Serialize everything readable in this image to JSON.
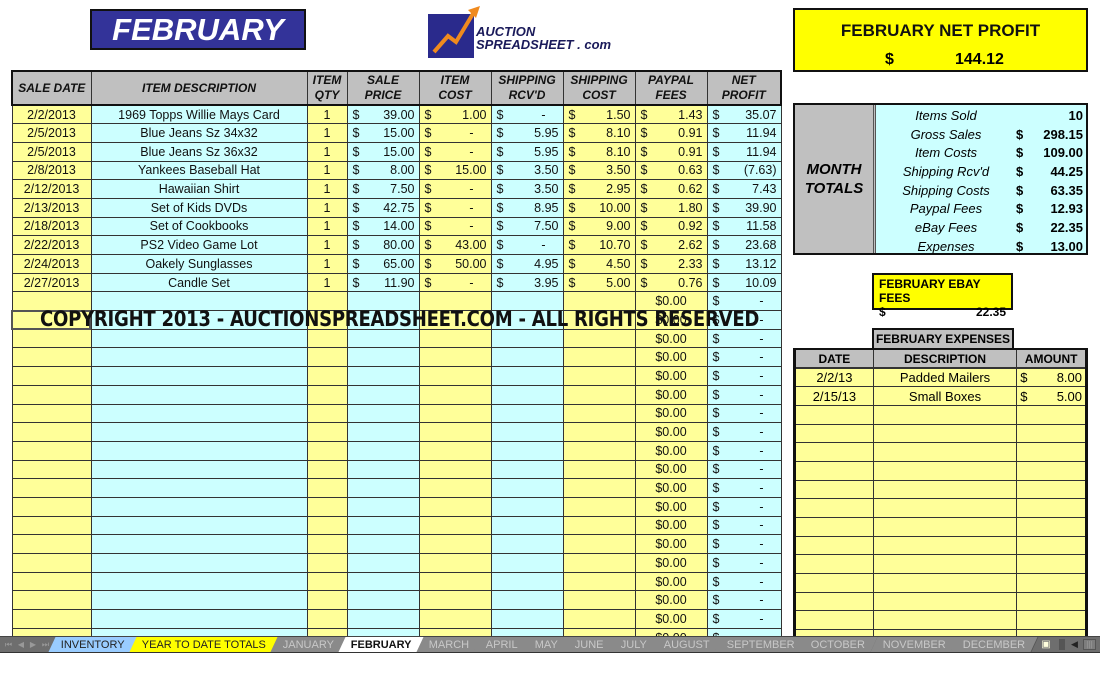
{
  "header": {
    "month_title": "FEBRUARY",
    "logo_line1": "AUCTION",
    "logo_line2": "SPREADSHEET . com",
    "net_profit_label": "FEBRUARY NET PROFIT",
    "net_profit_currency": "$",
    "net_profit_value": "144.12"
  },
  "sales_table": {
    "columns": [
      "SALE DATE",
      "ITEM DESCRIPTION",
      "ITEM QTY",
      "SALE PRICE",
      "ITEM COST",
      "SHIPPING RCV'D",
      "SHIPPING COST",
      "PAYPAL FEES",
      "NET PROFIT"
    ],
    "column_lines": [
      [
        "SALE DATE"
      ],
      [
        "ITEM DESCRIPTION"
      ],
      [
        "ITEM",
        "QTY"
      ],
      [
        "SALE",
        "PRICE"
      ],
      [
        "ITEM",
        "COST"
      ],
      [
        "SHIPPING",
        "RCV'D"
      ],
      [
        "SHIPPING",
        "COST"
      ],
      [
        "PAYPAL",
        "FEES"
      ],
      [
        "NET",
        "PROFIT"
      ]
    ],
    "rows": [
      {
        "date": "2/2/2013",
        "desc": "1969 Topps Willie Mays Card",
        "qty": "1",
        "price": "39.00",
        "cost": "1.00",
        "ship_rcvd": "-",
        "ship_cost": "1.50",
        "paypal": "1.43",
        "net": "35.07"
      },
      {
        "date": "2/5/2013",
        "desc": "Blue Jeans Sz 34x32",
        "qty": "1",
        "price": "15.00",
        "cost": "-",
        "ship_rcvd": "5.95",
        "ship_cost": "8.10",
        "paypal": "0.91",
        "net": "11.94"
      },
      {
        "date": "2/5/2013",
        "desc": "Blue Jeans Sz 36x32",
        "qty": "1",
        "price": "15.00",
        "cost": "-",
        "ship_rcvd": "5.95",
        "ship_cost": "8.10",
        "paypal": "0.91",
        "net": "11.94"
      },
      {
        "date": "2/8/2013",
        "desc": "Yankees Baseball Hat",
        "qty": "1",
        "price": "8.00",
        "cost": "15.00",
        "ship_rcvd": "3.50",
        "ship_cost": "3.50",
        "paypal": "0.63",
        "net": "(7.63)"
      },
      {
        "date": "2/12/2013",
        "desc": "Hawaiian Shirt",
        "qty": "1",
        "price": "7.50",
        "cost": "-",
        "ship_rcvd": "3.50",
        "ship_cost": "2.95",
        "paypal": "0.62",
        "net": "7.43"
      },
      {
        "date": "2/13/2013",
        "desc": "Set of Kids DVDs",
        "qty": "1",
        "price": "42.75",
        "cost": "-",
        "ship_rcvd": "8.95",
        "ship_cost": "10.00",
        "paypal": "1.80",
        "net": "39.90"
      },
      {
        "date": "2/18/2013",
        "desc": "Set of Cookbooks",
        "qty": "1",
        "price": "14.00",
        "cost": "-",
        "ship_rcvd": "7.50",
        "ship_cost": "9.00",
        "paypal": "0.92",
        "net": "11.58"
      },
      {
        "date": "2/22/2013",
        "desc": "PS2 Video Game Lot",
        "qty": "1",
        "price": "80.00",
        "cost": "43.00",
        "ship_rcvd": "-",
        "ship_cost": "10.70",
        "paypal": "2.62",
        "net": "23.68"
      },
      {
        "date": "2/24/2013",
        "desc": "Oakely Sunglasses",
        "qty": "1",
        "price": "65.00",
        "cost": "50.00",
        "ship_rcvd": "4.95",
        "ship_cost": "4.50",
        "paypal": "2.33",
        "net": "13.12"
      },
      {
        "date": "2/27/2013",
        "desc": "Candle Set",
        "qty": "1",
        "price": "11.90",
        "cost": "-",
        "ship_rcvd": "3.95",
        "ship_cost": "5.00",
        "paypal": "0.76",
        "net": "10.09"
      }
    ],
    "empty_row_paypal": "$0.00",
    "empty_row_net_currency": "$",
    "empty_row_net_value": "-",
    "empty_row_count": 19,
    "currency": "$"
  },
  "watermark": "COPYRIGHT 2013 - AUCTIONSPREADSHEET.COM - ALL RIGHTS RESERVED",
  "month_totals": {
    "label_line1": "MONTH",
    "label_line2": "TOTALS",
    "rows": [
      {
        "label": "Items Sold",
        "currency": "",
        "value": "10"
      },
      {
        "label": "Gross Sales",
        "currency": "$",
        "value": "298.15"
      },
      {
        "label": "Item Costs",
        "currency": "$",
        "value": "109.00"
      },
      {
        "label": "Shipping Rcv'd",
        "currency": "$",
        "value": "44.25"
      },
      {
        "label": "Shipping Costs",
        "currency": "$",
        "value": "63.35"
      },
      {
        "label": "Paypal Fees",
        "currency": "$",
        "value": "12.93"
      },
      {
        "label": "eBay Fees",
        "currency": "$",
        "value": "22.35"
      },
      {
        "label": "Expenses",
        "currency": "$",
        "value": "13.00"
      }
    ]
  },
  "ebay_fees": {
    "label": "FEBRUARY EBAY FEES",
    "currency": "$",
    "value": "22.35"
  },
  "expenses": {
    "title": "FEBRUARY EXPENSES",
    "columns": [
      "DATE",
      "DESCRIPTION",
      "AMOUNT"
    ],
    "rows": [
      {
        "date": "2/2/13",
        "desc": "Padded Mailers",
        "currency": "$",
        "amount": "8.00"
      },
      {
        "date": "2/15/13",
        "desc": "Small Boxes",
        "currency": "$",
        "amount": "5.00"
      }
    ],
    "empty_row_count": 13
  },
  "sheet_tabs": {
    "tabs": [
      {
        "label": "INVENTORY",
        "style": "inv"
      },
      {
        "label": "YEAR TO DATE TOTALS",
        "style": "ytd"
      },
      {
        "label": "JANUARY",
        "style": ""
      },
      {
        "label": "FEBRUARY",
        "style": "active"
      },
      {
        "label": "MARCH",
        "style": ""
      },
      {
        "label": "APRIL",
        "style": ""
      },
      {
        "label": "MAY",
        "style": ""
      },
      {
        "label": "JUNE",
        "style": ""
      },
      {
        "label": "JULY",
        "style": ""
      },
      {
        "label": "AUGUST",
        "style": ""
      },
      {
        "label": "SEPTEMBER",
        "style": ""
      },
      {
        "label": "OCTOBER",
        "style": ""
      },
      {
        "label": "NOVEMBER",
        "style": ""
      },
      {
        "label": "DECEMBER",
        "style": ""
      }
    ],
    "nav_icons": [
      "first-sheet-icon",
      "prev-sheet-icon",
      "next-sheet-icon",
      "last-sheet-icon"
    ]
  },
  "colors": {
    "title_bg": "#333399",
    "highlight_yellow": "#ffff00",
    "cell_yellow": "#ffff99",
    "cell_cyan": "#ccffff",
    "header_gray": "#c0c0c0"
  }
}
